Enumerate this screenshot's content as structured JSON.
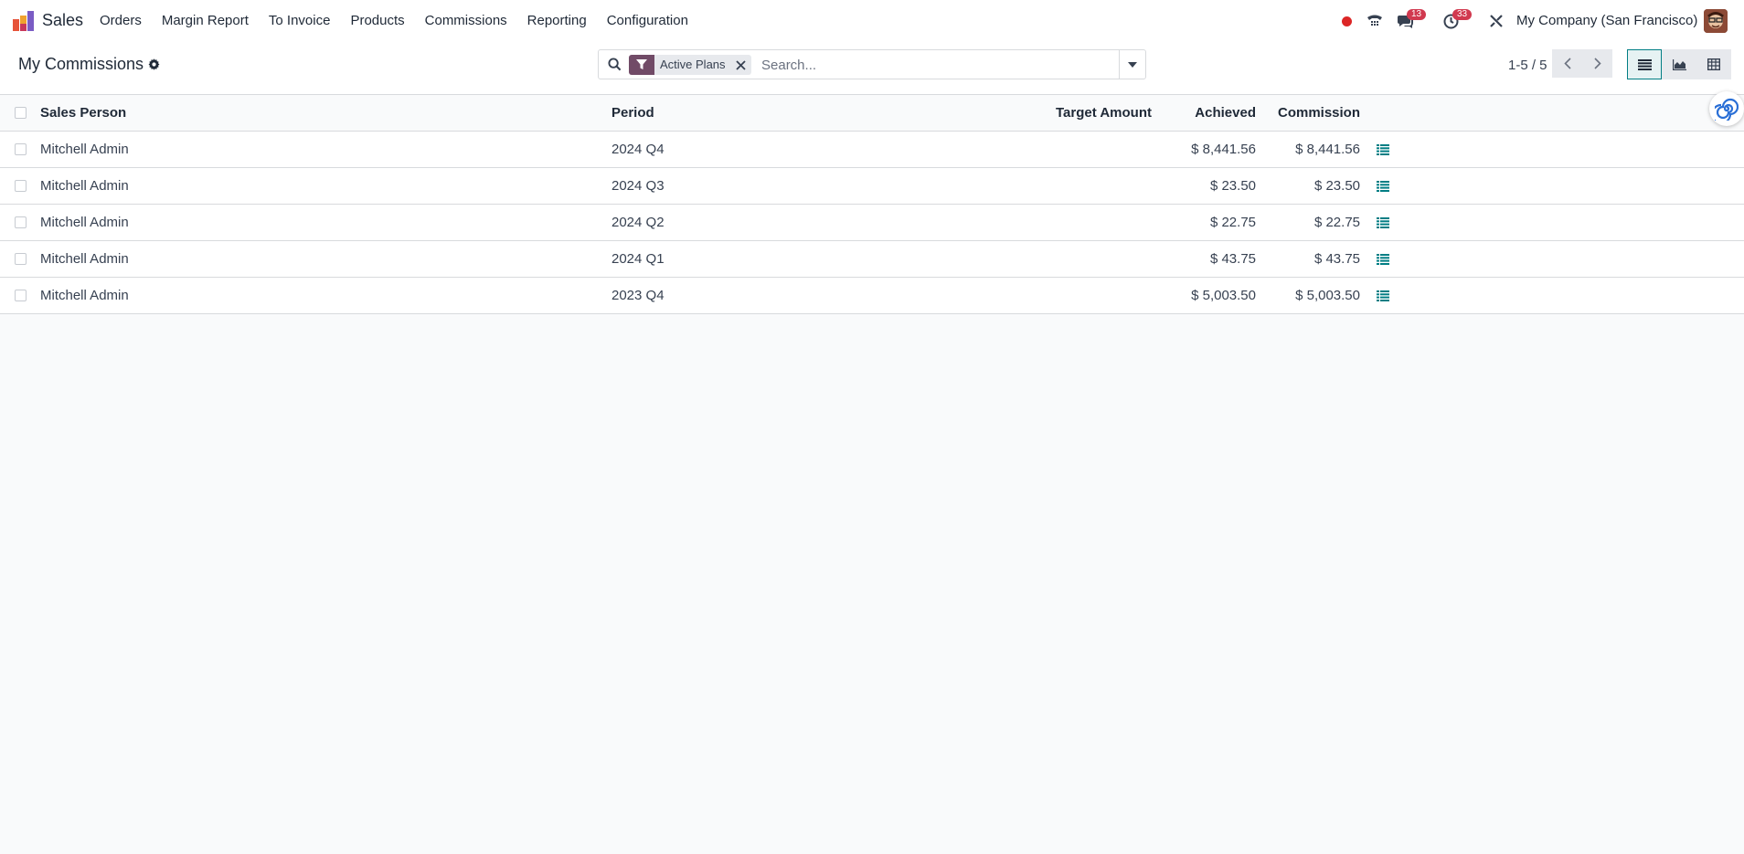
{
  "navbar": {
    "app_name": "Sales",
    "menu": [
      "Orders",
      "Margin Report",
      "To Invoice",
      "Products",
      "Commissions",
      "Reporting",
      "Configuration"
    ],
    "messages_badge": "13",
    "activities_badge": "33",
    "company": "My Company (San Francisco)"
  },
  "control_panel": {
    "title": "My Commissions",
    "facet_label": "Active Plans",
    "search_placeholder": "Search...",
    "pager": "1-5 / 5"
  },
  "table": {
    "columns": {
      "sales_person": "Sales Person",
      "period": "Period",
      "target_amount": "Target Amount",
      "achieved": "Achieved",
      "commission": "Commission"
    },
    "rows": [
      {
        "sales_person": "Mitchell Admin",
        "period": "2024 Q4",
        "target_amount": "",
        "achieved": "$ 8,441.56",
        "commission": "$ 8,441.56"
      },
      {
        "sales_person": "Mitchell Admin",
        "period": "2024 Q3",
        "target_amount": "",
        "achieved": "$ 23.50",
        "commission": "$ 23.50"
      },
      {
        "sales_person": "Mitchell Admin",
        "period": "2024 Q2",
        "target_amount": "",
        "achieved": "$ 22.75",
        "commission": "$ 22.75"
      },
      {
        "sales_person": "Mitchell Admin",
        "period": "2024 Q1",
        "target_amount": "",
        "achieved": "$ 43.75",
        "commission": "$ 43.75"
      },
      {
        "sales_person": "Mitchell Admin",
        "period": "2023 Q4",
        "target_amount": "",
        "achieved": "$ 5,003.50",
        "commission": "$ 5,003.50"
      }
    ]
  },
  "colors": {
    "brand": "#714b67",
    "accent": "#017e84",
    "badge": "#d1394f"
  }
}
